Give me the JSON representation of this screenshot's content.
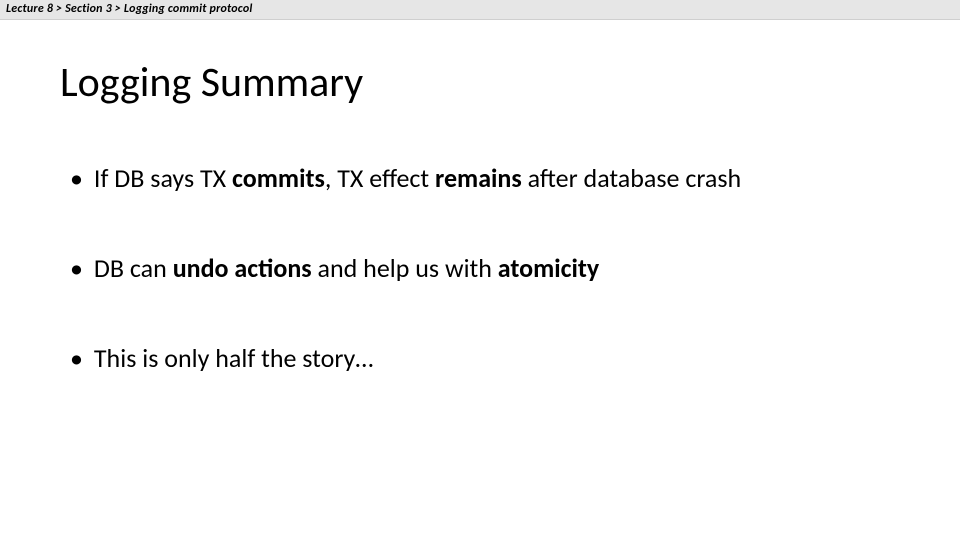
{
  "breadcrumb": {
    "text": "Lecture 8 > Section 3 > Logging commit protocol"
  },
  "slide": {
    "title": "Logging Summary",
    "bullets": [
      {
        "pre": "If DB says TX ",
        "b1": "commits",
        "mid": ", TX effect ",
        "b2": "remains",
        "post": " after database crash"
      },
      {
        "pre": "DB can ",
        "b1": "undo actions",
        "mid": " and help us with ",
        "b2": "atomicity",
        "post": ""
      },
      {
        "pre": "This is only half the story…",
        "b1": "",
        "mid": "",
        "b2": "",
        "post": ""
      }
    ]
  }
}
